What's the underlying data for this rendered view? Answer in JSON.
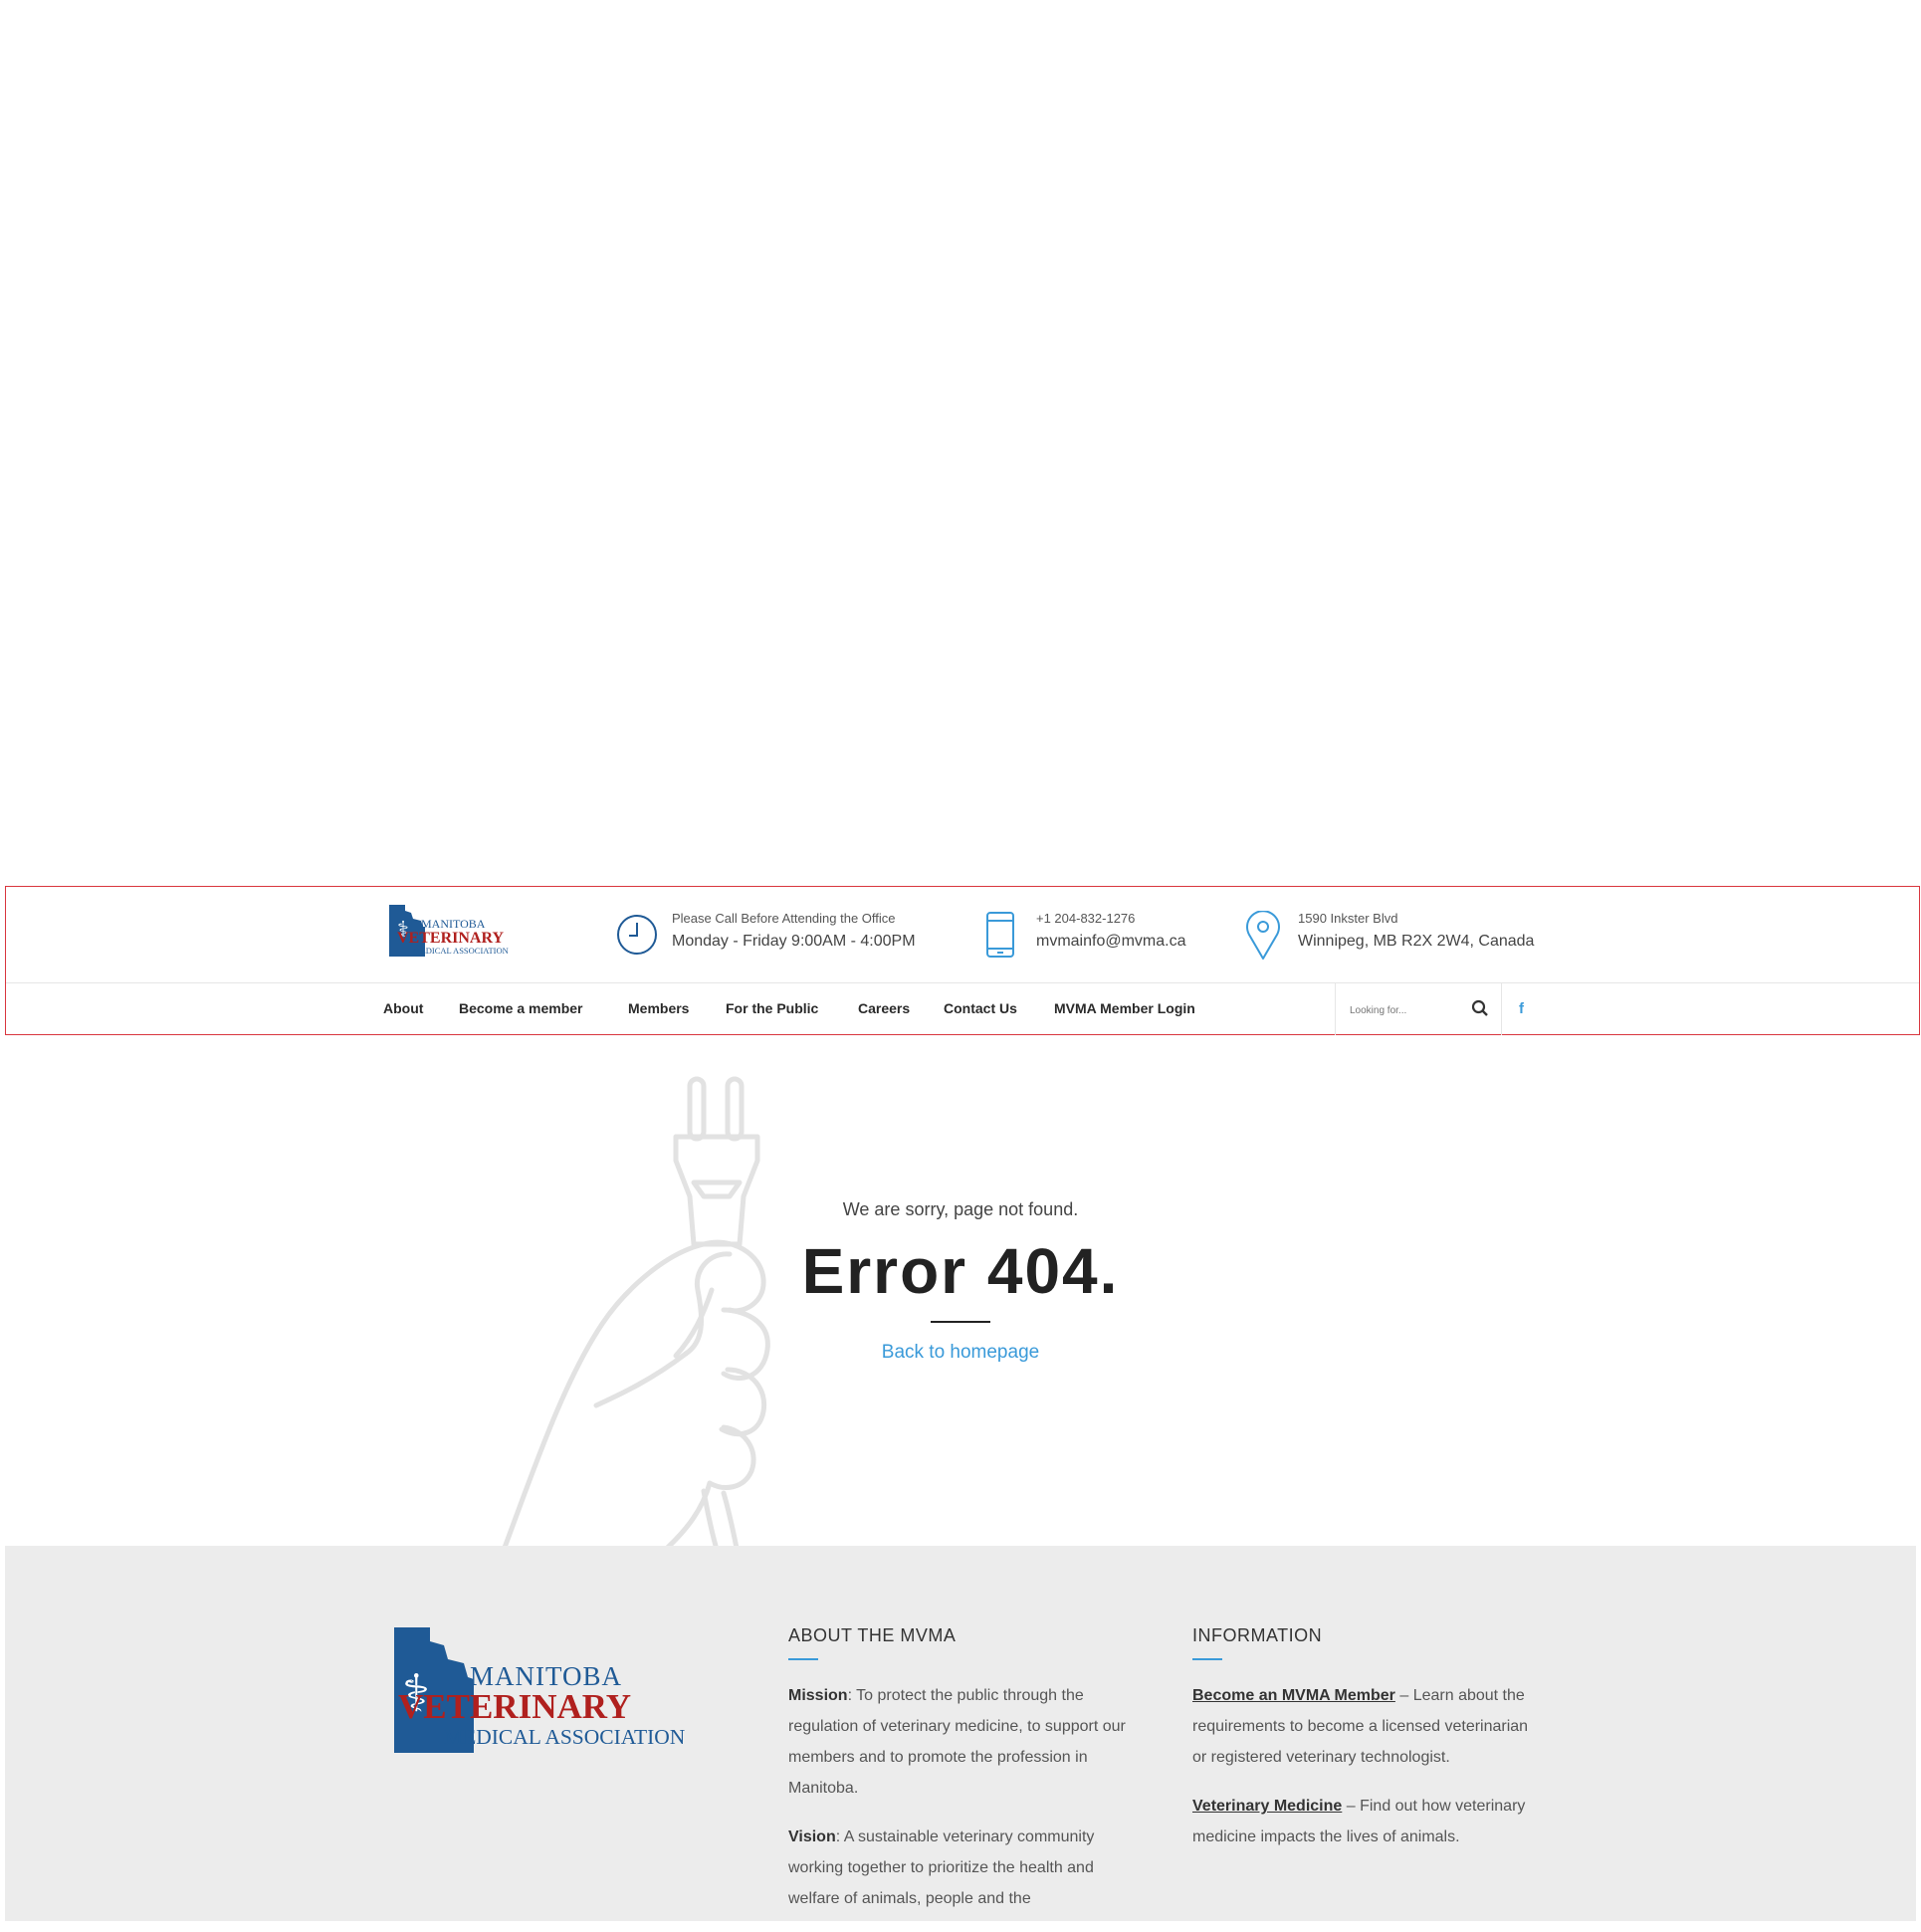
{
  "header": {
    "logo": {
      "line1": "MANITOBA",
      "line2": "VETERINARY",
      "line3": "MEDICAL ASSOCIATION"
    },
    "hours": {
      "small": "Please Call Before Attending the Office",
      "big": "Monday - Friday 9:00AM - 4:00PM",
      "icon": "clock-icon"
    },
    "contact": {
      "small": "+1 204-832-1276",
      "big": "mvmainfo@mvma.ca",
      "icon": "phone-icon"
    },
    "address": {
      "small": "1590 Inkster Blvd",
      "big": "Winnipeg, MB R2X 2W4, Canada",
      "icon": "map-pin-icon"
    },
    "nav": {
      "about": "About",
      "become_member": "Become a member",
      "members": "Members",
      "for_public": "For the Public",
      "careers": "Careers",
      "contact": "Contact Us",
      "login": "MVMA Member Login"
    },
    "search": {
      "placeholder": "Looking for...",
      "icon": "search-icon"
    },
    "social": {
      "facebook": "f"
    }
  },
  "error_page": {
    "sorry": "We are sorry, page not found.",
    "title": "Error 404.",
    "back_link": "Back to homepage"
  },
  "footer": {
    "logo": {
      "line1": "MANITOBA",
      "line2": "VETERINARY",
      "line3": "MEDICAL ASSOCIATION"
    },
    "about": {
      "heading": "ABOUT THE MVMA",
      "mission_label": "Mission",
      "mission_text": ": To protect the public through the regulation of veterinary medicine, to support our members and to promote the profession in Manitoba.",
      "vision_label": "Vision",
      "vision_text": ": A sustainable veterinary community working together to prioritize the health and welfare of animals, people and the"
    },
    "information": {
      "heading": "INFORMATION",
      "item1_link": "Become an MVMA Member",
      "item1_text": " – Learn about the requirements to become a licensed veterinarian or registered veterinary technologist.",
      "item2_link": "Veterinary Medicine",
      "item2_text": " – Find out how veterinary medicine impacts the lives of animals."
    }
  },
  "colors": {
    "accent": "#3a9ad9",
    "brand_blue": "#1f5a96",
    "brand_red": "#b0201e",
    "border_red": "#d9363e",
    "footer_bg": "#ececec"
  }
}
